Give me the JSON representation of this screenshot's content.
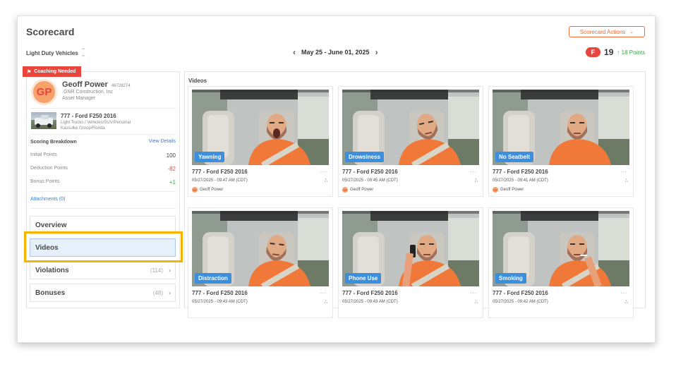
{
  "header": {
    "title": "Scorecard",
    "actions_label": "Scorecard Actions",
    "vehicle_filter": "Light Duty Vehicles",
    "date_range": "May 25 - June 01, 2025",
    "grade": "F",
    "score": "19",
    "points_delta": "18 Points"
  },
  "driver": {
    "flag_label": "Coaching Needed",
    "initials": "GP",
    "name": "Geoff Power",
    "id": "46728274",
    "company": ".GNR Construction, Inc",
    "role": "Asset Manager"
  },
  "vehicle": {
    "name": "777 - Ford F250 2016",
    "type": "Light Trucks / Vehicles/SUV/Personal",
    "group": "Kassulke Group/Florida"
  },
  "scoring": {
    "label": "Scoring Breakdown",
    "view_details": "View Details",
    "rows": [
      {
        "label": "Initial Points",
        "value": "100",
        "color": "#444444"
      },
      {
        "label": "Deduction Points",
        "value": "-82",
        "color": "#e8453c"
      },
      {
        "label": "Bonus Points",
        "value": "+1",
        "color": "#3fa34d"
      }
    ],
    "attachments": "Attachments (0)"
  },
  "nav": {
    "overview": "Overview",
    "videos": "Videos",
    "violations": "Violations",
    "violations_count": "(114)",
    "bonuses": "Bonuses",
    "bonuses_count": "(48)"
  },
  "videos": {
    "title": "Videos",
    "cards": [
      {
        "event": "Yawning",
        "vehicle": "777 - Ford F250 2016",
        "time": "05/27/2025 - 09:47 AM (CDT)",
        "driver": "Geoff Power",
        "more": "...",
        "pose": "yawn"
      },
      {
        "event": "Drowsiness",
        "vehicle": "777 - Ford F250 2016",
        "time": "05/27/2025 - 09:45 AM (CDT)",
        "driver": "Geoff Power",
        "more": "...",
        "pose": "tilt"
      },
      {
        "event": "No Seatbelt",
        "vehicle": "777 - Ford F250 2016",
        "time": "05/27/2025 - 09:41 AM (CDT)",
        "driver": "Geoff Power",
        "more": "...",
        "pose": "noseatbelt"
      },
      {
        "event": "Distraction",
        "vehicle": "777 - Ford F250 2016",
        "time": "05/27/2025 - 09:43 AM (CDT)",
        "driver": "",
        "more": "...",
        "pose": "side"
      },
      {
        "event": "Phone Use",
        "vehicle": "777 - Ford F250 2016",
        "time": "05/27/2025 - 09:43 AM (CDT)",
        "driver": "",
        "more": "...",
        "pose": "phone"
      },
      {
        "event": "Smoking",
        "vehicle": "777 - Ford F250 2016",
        "time": "05/27/2025 - 09:42 AM (CDT)",
        "driver": "",
        "more": "...",
        "pose": "smoke"
      }
    ]
  },
  "colors": {
    "accent": "#ef6b35",
    "danger": "#e8453c",
    "success": "#3fa34d",
    "link": "#3b7ddd",
    "event_label": "#3b8fde",
    "highlight": "#f4b400"
  }
}
